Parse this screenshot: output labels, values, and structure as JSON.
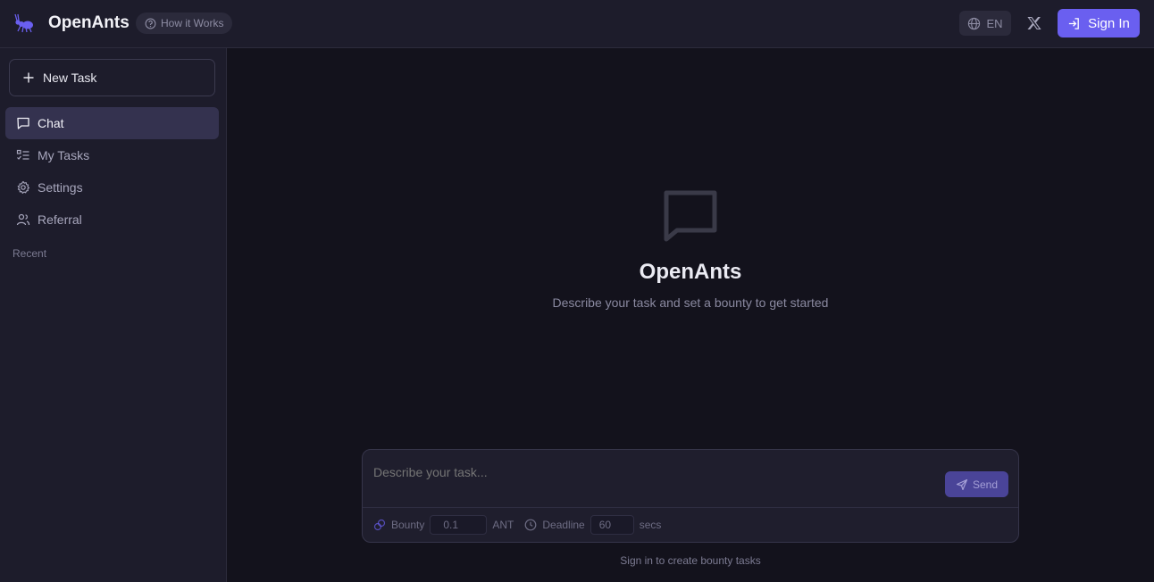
{
  "header": {
    "brand": "OpenAnts",
    "how_it_works": "How it Works",
    "language": "EN",
    "sign_in": "Sign In"
  },
  "sidebar": {
    "new_task": "New Task",
    "items": [
      {
        "label": "Chat",
        "icon": "chat-icon",
        "active": true
      },
      {
        "label": "My Tasks",
        "icon": "tasks-icon",
        "active": false
      },
      {
        "label": "Settings",
        "icon": "gear-icon",
        "active": false
      },
      {
        "label": "Referral",
        "icon": "users-icon",
        "active": false
      }
    ],
    "recent_label": "Recent"
  },
  "main": {
    "title": "OpenAnts",
    "subtitle": "Describe your task and set a bounty to get started",
    "composer": {
      "placeholder": "Describe your task...",
      "send_label": "Send",
      "bounty_label": "Bounty",
      "bounty_value": "0.1",
      "bounty_unit": "ANT",
      "deadline_label": "Deadline",
      "deadline_value": "60",
      "deadline_unit": "secs"
    },
    "hint": "Sign in to create bounty tasks"
  },
  "colors": {
    "accent": "#6a5ff0",
    "background": "#13121c",
    "sidebar": "#1d1c2b"
  }
}
